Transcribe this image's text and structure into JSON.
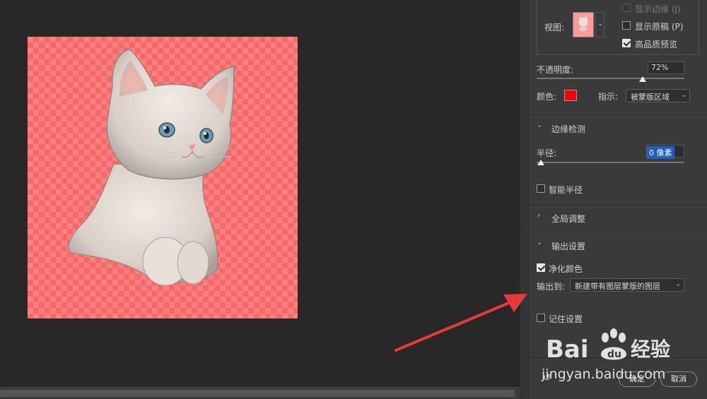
{
  "options": {
    "show_edge": "显示边缘 (J)",
    "show_original": "显示原稿 (P)",
    "high_quality": "高品质预览",
    "view_label": "视图:"
  },
  "opacity": {
    "label": "不透明度:",
    "value": "72%",
    "fraction": 0.72
  },
  "color_row": {
    "label": "颜色:",
    "swatch": "#ff0000",
    "indicate_label": "指示:",
    "indicate_value": "被蒙版区域"
  },
  "edge_detection": {
    "title": "边缘检测",
    "radius_label": "半径:",
    "radius_value": "0 像素",
    "smart_radius": "智能半径"
  },
  "global_adjust": {
    "title": "全局调整"
  },
  "output_settings": {
    "title": "输出设置",
    "decontaminate": "净化颜色",
    "output_to_label": "输出到:",
    "output_to_value": "新建带有图层蒙版的图层"
  },
  "remember": "记住设置",
  "buttons": {
    "ok": "确定",
    "cancel": "取消"
  },
  "watermark": {
    "brand": "Bai",
    "brand2": "经验",
    "url": "jingyan.baidu.com"
  },
  "colors": {
    "panel": "#3a3a3a",
    "canvas": "#282828",
    "overlay": "#ff7f7f",
    "arrow": "#e8393a"
  }
}
